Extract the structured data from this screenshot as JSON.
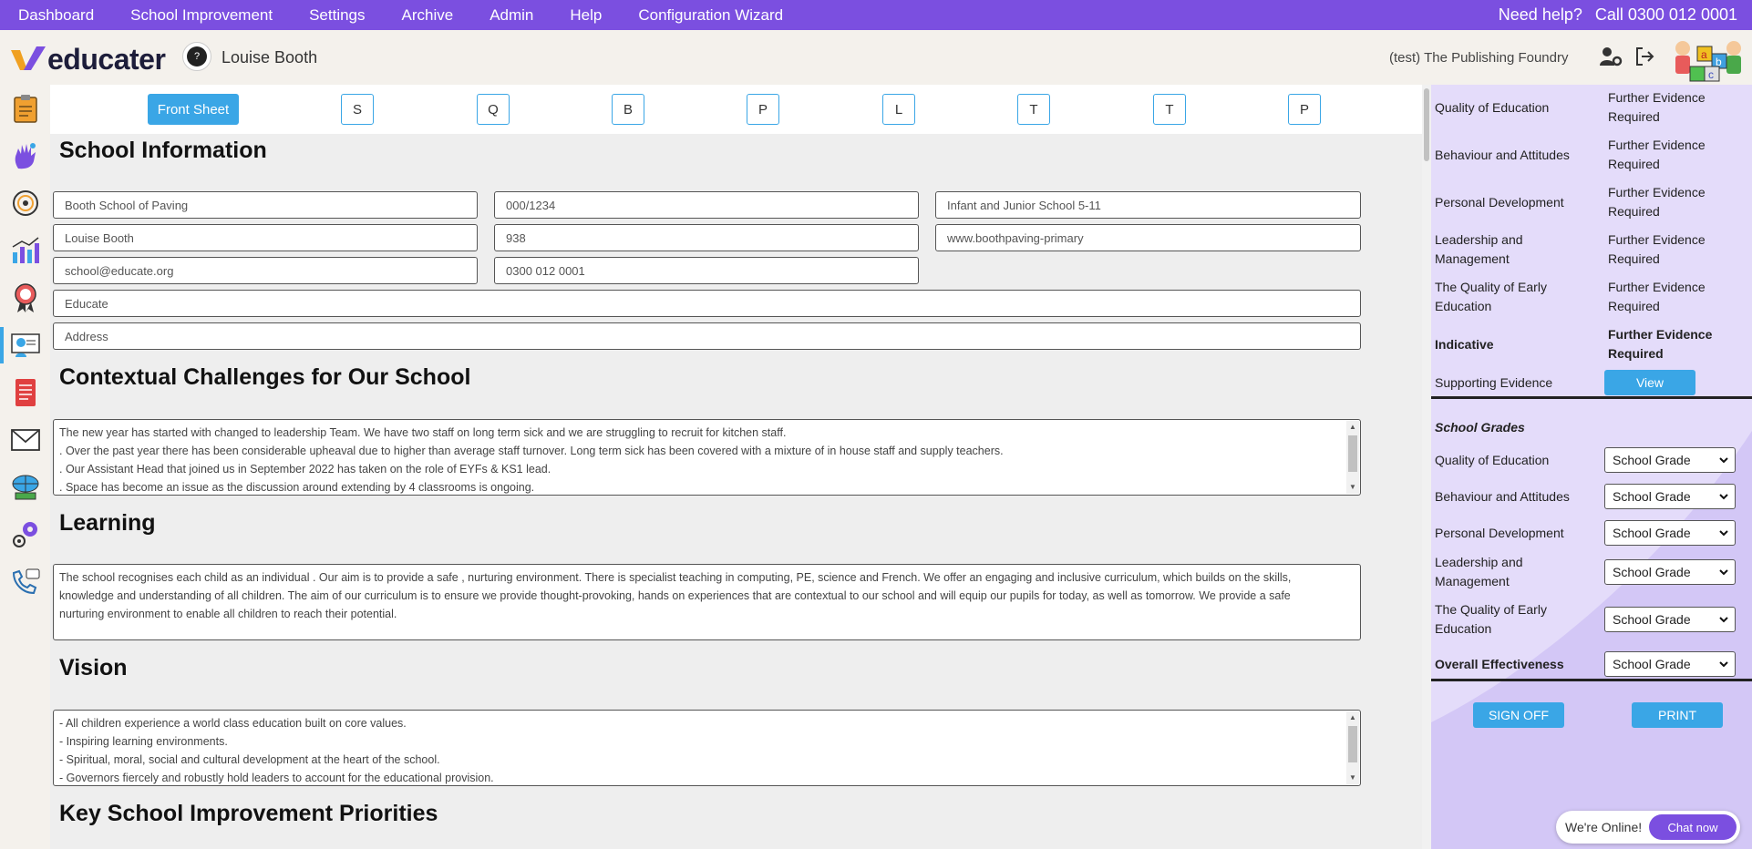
{
  "topnav": {
    "items": [
      "Dashboard",
      "School Improvement",
      "Settings",
      "Archive",
      "Admin",
      "Help",
      "Configuration Wizard"
    ],
    "help_label": "Need help?",
    "help_phone": "Call 0300 012 0001"
  },
  "header": {
    "logo_text": "educater",
    "user_name": "Louise Booth",
    "org_name": "(test) The Publishing Foundry"
  },
  "tabs": [
    "Front Sheet",
    "S",
    "Q",
    "B",
    "P",
    "L",
    "T",
    "T",
    "P"
  ],
  "school_info": {
    "heading": "School Information",
    "fields": {
      "school_name": "Booth School of Paving",
      "urn": "000/1234",
      "phase": "Infant and Junior School 5-11",
      "head": "Louise Booth",
      "pupils": "938",
      "website": "www.boothpaving-primary",
      "email": "school@educate.org",
      "phone": "0300 012 0001",
      "trust": "Educate",
      "address": "Address"
    }
  },
  "contextual": {
    "heading": "Contextual Challenges for Our School",
    "lines": [
      "The new year has started with changed to leadership Team.  We have two staff on long term sick and we are struggling to recruit for kitchen staff.",
      ". Over the past year there has been considerable upheaval  due to higher than average staff turnover. Long term sick has been covered with a mixture of in house staff and supply teachers.",
      ". Our Assistant Head that joined us in September 2022 has taken on the role of EYFs & KS1 lead.",
      ". Space has become an issue as the discussion around extending by 4 classrooms is ongoing."
    ]
  },
  "learning": {
    "heading": "Learning",
    "lines": [
      "The school recognises each child as an individual . Our aim is to provide a safe , nurturing environment. There is specialist teaching in computing, PE, science and French. We offer an engaging and inclusive curriculum, which builds on the skills,",
      "knowledge and understanding of all children. The aim of our curriculum is to ensure we provide thought-provoking, hands on experiences that are contextual to our school and will equip our pupils for today, as well as tomorrow. We provide a safe",
      "nurturing environment to enable all children to reach their potential."
    ]
  },
  "vision": {
    "heading": "Vision",
    "lines": [
      "- All children experience a world class education built on core values.",
      "- Inspiring learning environments.",
      "- Spiritual, moral, social and cultural development at the heart of the school.",
      "- Governors fiercely and robustly hold leaders to account for the educational provision."
    ]
  },
  "priorities": {
    "heading": "Key School Improvement Priorities"
  },
  "judgements": [
    {
      "label": "Quality of Education",
      "value": "Further Evidence Required"
    },
    {
      "label": "Behaviour and Attitudes",
      "value": "Further Evidence Required"
    },
    {
      "label": "Personal Development",
      "value": "Further Evidence Required"
    },
    {
      "label": "Leadership and Management",
      "value": "Further Evidence Required"
    },
    {
      "label": "The Quality of Early Education",
      "value": "Further Evidence Required"
    },
    {
      "label": "Indicative",
      "value": "Further Evidence Required"
    }
  ],
  "supporting": {
    "label": "Supporting Evidence",
    "button": "View"
  },
  "school_grades": {
    "heading": "School Grades",
    "rows": [
      {
        "label": "Quality of Education",
        "value": "School Grade"
      },
      {
        "label": "Behaviour and Attitudes",
        "value": "School Grade"
      },
      {
        "label": "Personal Development",
        "value": "School Grade"
      },
      {
        "label": "Leadership and Management",
        "value": "School Grade"
      },
      {
        "label": "The Quality of Early Education",
        "value": "School Grade"
      },
      {
        "label": "Overall Effectiveness",
        "value": "School Grade"
      }
    ]
  },
  "actions": {
    "sign_off": "SIGN OFF",
    "print": "PRINT"
  },
  "chat": {
    "status": "We're Online!",
    "button": "Chat now"
  },
  "colors": {
    "nav": "#7b4fe0",
    "accent": "#3aa6e6",
    "panel": "#e4dcfa"
  }
}
